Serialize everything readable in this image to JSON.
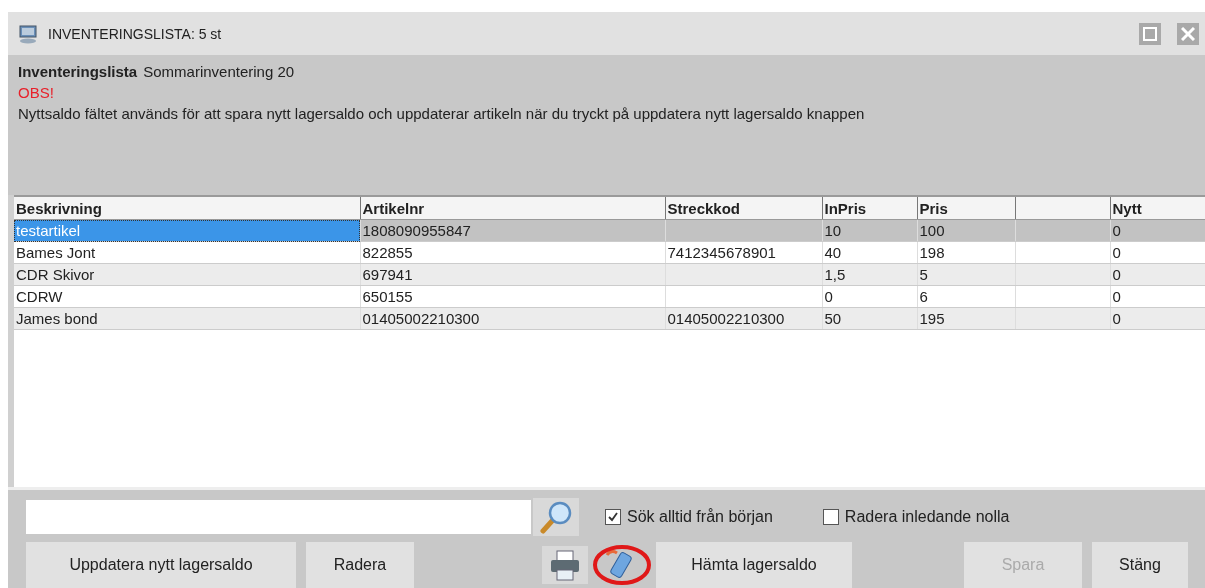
{
  "window": {
    "title": "INVENTERINGSLISTA:  5 st"
  },
  "header": {
    "label": "Inventeringslista",
    "name": "Sommarinventering 20",
    "warning": "OBS!",
    "message": "Nyttsaldo fältet används för att spara nytt lagersaldo och uppdaterar artikeln när du tryckt på uppdatera nytt lagersaldo knappen"
  },
  "table": {
    "columns": [
      "Beskrivning",
      "Artikelnr",
      "Streckkod",
      "InPris",
      "Pris",
      "",
      "Nytt"
    ],
    "rows": [
      {
        "selected": true,
        "cells": [
          "testartikel",
          "1808090955847",
          "",
          "10",
          "100",
          "",
          "0"
        ]
      },
      {
        "selected": false,
        "cells": [
          "Bames Jont",
          "822855",
          "7412345678901",
          "40",
          "198",
          "",
          "0"
        ]
      },
      {
        "selected": false,
        "cells": [
          "CDR Skivor",
          "697941",
          "",
          "1,5",
          "5",
          "",
          "0"
        ]
      },
      {
        "selected": false,
        "cells": [
          "CDRW",
          "650155",
          "",
          "0",
          "6",
          "",
          "0"
        ]
      },
      {
        "selected": false,
        "cells": [
          "James bond",
          "01405002210300",
          "01405002210300",
          "50",
          "195",
          "",
          "0"
        ]
      }
    ]
  },
  "search": {
    "options": [
      {
        "label": "Sök alltid från början",
        "checked": true
      },
      {
        "label": "Radera inledande nolla",
        "checked": false
      }
    ]
  },
  "buttons": [
    {
      "kind": "text",
      "label": "Uppdatera nytt lagersaldo",
      "disabled": false
    },
    {
      "kind": "text",
      "label": "Radera",
      "disabled": false
    },
    {
      "kind": "printer"
    },
    {
      "kind": "phone",
      "annotated": true
    },
    {
      "kind": "text",
      "label": "Hämta lagersaldo",
      "disabled": false
    },
    {
      "kind": "text",
      "label": "Spara",
      "disabled": true
    },
    {
      "kind": "text",
      "label": "Stäng",
      "disabled": false
    }
  ]
}
